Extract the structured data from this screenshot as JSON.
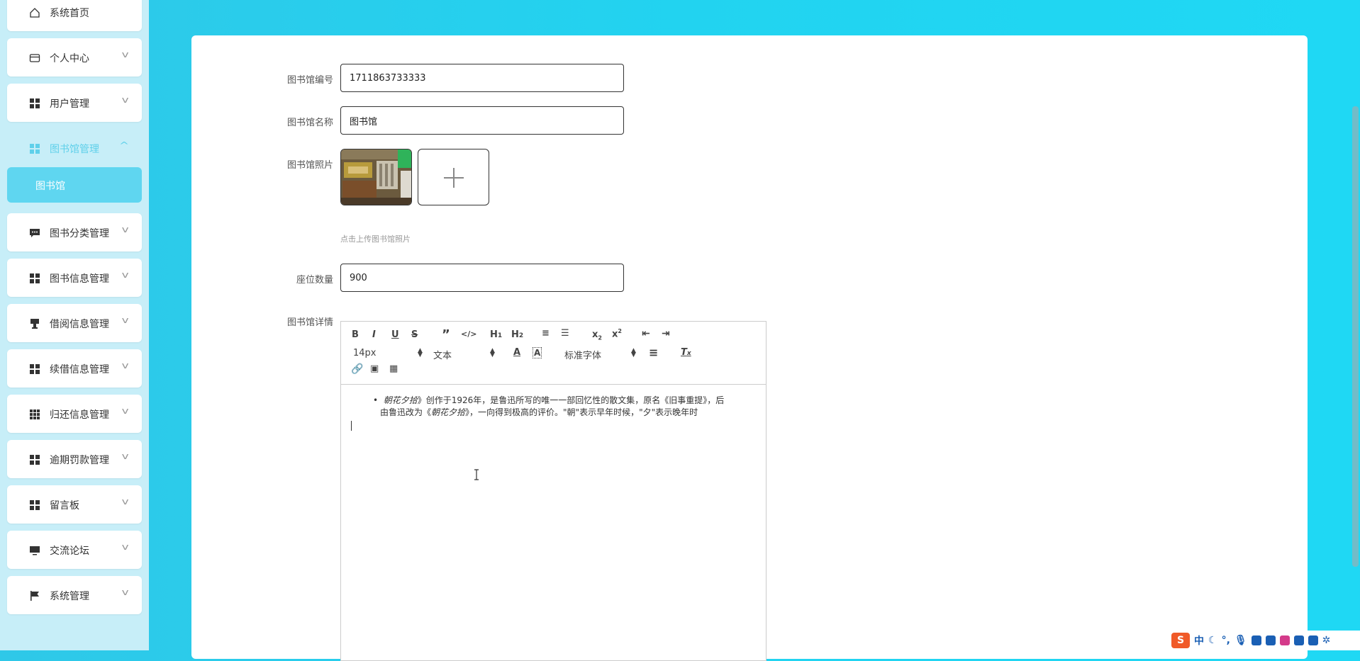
{
  "sidebar": {
    "items": [
      {
        "label": "系统首页",
        "icon": "home-icon",
        "chevron": false
      },
      {
        "label": "个人中心",
        "icon": "card-icon",
        "chevron": true
      },
      {
        "label": "用户管理",
        "icon": "grid-icon",
        "chevron": true
      },
      {
        "label": "图书馆管理",
        "icon": "grid-icon",
        "chevron": true,
        "active": true
      },
      {
        "label": "图书分类管理",
        "icon": "message-icon",
        "chevron": true
      },
      {
        "label": "图书信息管理",
        "icon": "grid-icon",
        "chevron": true
      },
      {
        "label": "借阅信息管理",
        "icon": "stamp-icon",
        "chevron": true
      },
      {
        "label": "续借信息管理",
        "icon": "grid-icon",
        "chevron": true
      },
      {
        "label": "归还信息管理",
        "icon": "dots-grid-icon",
        "chevron": true
      },
      {
        "label": "逾期罚款管理",
        "icon": "grid-icon",
        "chevron": true
      },
      {
        "label": "留言板",
        "icon": "grid-icon",
        "chevron": true
      },
      {
        "label": "交流论坛",
        "icon": "monitor-icon",
        "chevron": true
      },
      {
        "label": "系统管理",
        "icon": "flag-icon",
        "chevron": true
      }
    ],
    "submenu_active": "图书馆"
  },
  "form": {
    "library_no_label": "图书馆编号",
    "library_no_value": "1711863733333",
    "library_name_label": "图书馆名称",
    "library_name_value": "图书馆",
    "photo_label": "图书馆照片",
    "photo_hint": "点击上传图书馆照片",
    "seats_label": "座位数量",
    "seats_value": "900",
    "detail_label": "图书馆详情"
  },
  "editor": {
    "font_size": "14px",
    "format": "文本",
    "font_family": "标准字体",
    "content_line1_italic": "朝花夕拾",
    "content_line1_rest": "》创作于1926年，是鲁迅所写的唯一一部回忆性的散文集，原名《旧事重提》，后",
    "content_line2_prefix": "由鲁迅改为《",
    "content_line2_italic": "朝花夕拾",
    "content_line2_rest": "》，一向得到极高的评价。\"朝\"表示早年时候，\"夕\"表示晚年时"
  },
  "ime": {
    "logo": "S",
    "mode": "中"
  },
  "colors": {
    "accent": "#5fd6f0",
    "background": "#22d3f0"
  }
}
